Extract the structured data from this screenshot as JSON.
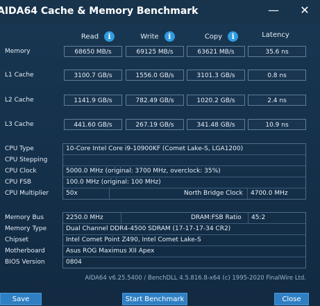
{
  "window": {
    "title": "AIDA64 Cache & Memory Benchmark",
    "minimize": "—",
    "close": "✕"
  },
  "columns": {
    "read": "Read",
    "write": "Write",
    "copy": "Copy",
    "latency": "Latency"
  },
  "rows": [
    {
      "label": "Memory",
      "read": "68650 MB/s",
      "write": "69125 MB/s",
      "copy": "63621 MB/s",
      "latency": "35.6 ns"
    },
    {
      "label": "L1 Cache",
      "read": "3100.7 GB/s",
      "write": "1556.0 GB/s",
      "copy": "3101.3 GB/s",
      "latency": "0.8 ns"
    },
    {
      "label": "L2 Cache",
      "read": "1141.9 GB/s",
      "write": "782.49 GB/s",
      "copy": "1020.2 GB/s",
      "latency": "2.4 ns"
    },
    {
      "label": "L3 Cache",
      "read": "441.60 GB/s",
      "write": "267.19 GB/s",
      "copy": "341.48 GB/s",
      "latency": "10.9 ns"
    }
  ],
  "cpu": {
    "type_label": "CPU Type",
    "type": "10-Core Intel Core i9-10900KF  (Comet Lake-S, LGA1200)",
    "stepping_label": "CPU Stepping",
    "stepping": "",
    "clock_label": "CPU Clock",
    "clock": "5000.0 MHz  (original: 3700 MHz, overclock: 35%)",
    "fsb_label": "CPU FSB",
    "fsb": "100.0 MHz  (original: 100 MHz)",
    "multiplier_label": "CPU Multiplier",
    "multiplier": "50x",
    "nb_clock_label": "North Bridge Clock",
    "nb_clock": "4700.0 MHz"
  },
  "memory": {
    "bus_label": "Memory Bus",
    "bus": "2250.0 MHz",
    "ratio_label": "DRAM:FSB Ratio",
    "ratio": "45:2",
    "type_label": "Memory Type",
    "type": "Dual Channel DDR4-4500 SDRAM  (17-17-17-34 CR2)",
    "chipset_label": "Chipset",
    "chipset": "Intel Comet Point Z490, Intel Comet Lake-S",
    "motherboard_label": "Motherboard",
    "motherboard": "Asus ROG Maximus XII Apex",
    "bios_label": "BIOS Version",
    "bios": "0804"
  },
  "footer": "AIDA64 v6.25.5400 / BenchDLL 4.5.816.8-x64  (c) 1995-2020 FinalWire Ltd.",
  "buttons": {
    "save": "Save",
    "start": "Start Benchmark",
    "close": "Close"
  },
  "icons": {
    "info": "info-icon"
  },
  "colors": {
    "accent": "#2f9be0",
    "button": "#2f7fc4",
    "background": "#15314b"
  }
}
